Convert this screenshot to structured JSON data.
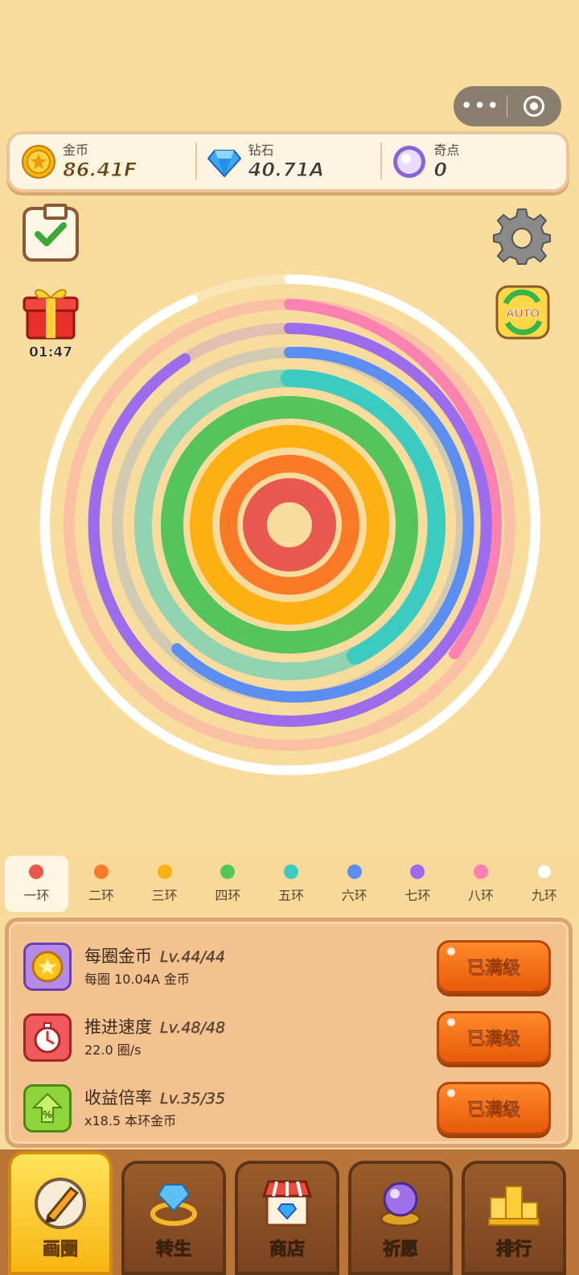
{
  "capsule": {
    "more_icon": "more-dots-icon",
    "close_icon": "target-circle-icon"
  },
  "resources": {
    "gold": {
      "label": "金币",
      "value": "86.41F",
      "icon": "gold-coin-icon"
    },
    "diamond": {
      "label": "钻石",
      "value": "40.71A",
      "icon": "diamond-icon"
    },
    "odd": {
      "label": "奇点",
      "value": "0",
      "icon": "purple-orb-icon"
    }
  },
  "side": {
    "gift_timer": "01:47",
    "auto_label": "AUTO"
  },
  "rings": [
    {
      "name": "一环",
      "color": "#e8584e"
    },
    {
      "name": "二环",
      "color": "#fb7a28"
    },
    {
      "name": "三环",
      "color": "#fdb012"
    },
    {
      "name": "四环",
      "color": "#55c45c"
    },
    {
      "name": "五环",
      "color": "#3ccbc0"
    },
    {
      "name": "六环",
      "color": "#5b8ef0"
    },
    {
      "name": "七环",
      "color": "#9d6cec"
    },
    {
      "name": "八环",
      "color": "#fb82b0"
    },
    {
      "name": "九环",
      "color": "#ffffff"
    }
  ],
  "upgrades": [
    {
      "name": "每圈金币",
      "level": "Lv.44/44",
      "desc": "每圈 10.04A 金币",
      "button": "已满级",
      "icon": "coin-upgrade-icon"
    },
    {
      "name": "推进速度",
      "level": "Lv.48/48",
      "desc": "22.0 圈/s",
      "button": "已满级",
      "icon": "stopwatch-icon"
    },
    {
      "name": "收益倍率",
      "level": "Lv.35/35",
      "desc": "x18.5 本环金币",
      "button": "已满级",
      "icon": "percent-arrow-icon"
    }
  ],
  "nav": [
    {
      "label": "画圈",
      "icon": "pencil-circle-icon",
      "active": true
    },
    {
      "label": "转生",
      "icon": "diamond-ring-icon",
      "active": false
    },
    {
      "label": "商店",
      "icon": "shop-icon",
      "active": false
    },
    {
      "label": "祈愿",
      "icon": "crystal-ball-icon",
      "active": false
    },
    {
      "label": "排行",
      "icon": "podium-icon",
      "active": false
    }
  ]
}
